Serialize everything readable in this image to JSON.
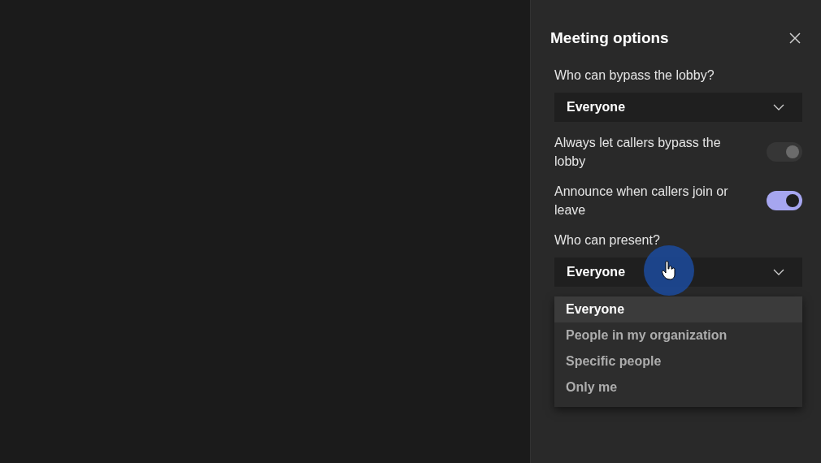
{
  "panel": {
    "title": "Meeting options"
  },
  "options": [
    {
      "kind": "dropdown",
      "label": "Who can bypass the lobby?",
      "value": "Everyone",
      "expanded": false
    },
    {
      "kind": "toggle",
      "label": "Always let callers bypass the lobby",
      "on": true,
      "disabled": true
    },
    {
      "kind": "toggle",
      "label": "Announce when callers join or leave",
      "on": true,
      "disabled": false
    },
    {
      "kind": "dropdown",
      "label": "Who can present?",
      "value": "Everyone",
      "expanded": true,
      "menu": [
        {
          "label": "Everyone",
          "selected": true
        },
        {
          "label": "People in my organization",
          "selected": false
        },
        {
          "label": "Specific people",
          "selected": false
        },
        {
          "label": "Only me",
          "selected": false
        }
      ]
    }
  ]
}
